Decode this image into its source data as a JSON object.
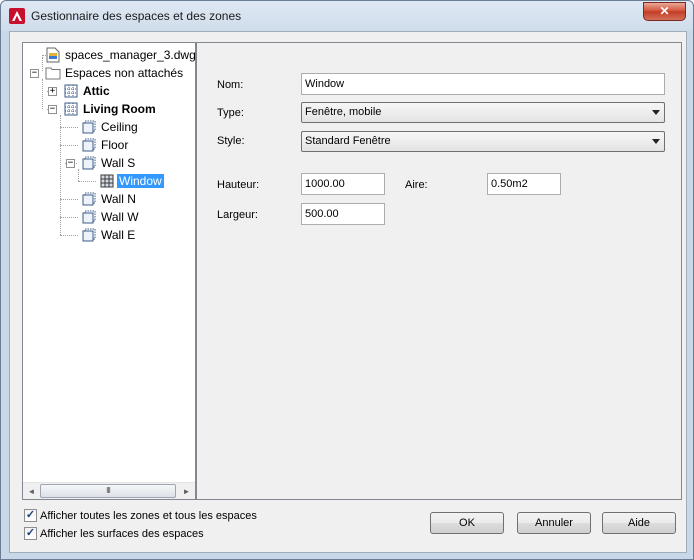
{
  "window": {
    "title": "Gestionnaire des espaces et des zones",
    "close_label": "✕"
  },
  "tree": {
    "file": "spaces_manager_3.dwg",
    "unattached": "Espaces non attachés",
    "attic": "Attic",
    "living_room": "Living Room",
    "ceiling": "Ceiling",
    "floor": "Floor",
    "wall_s": "Wall S",
    "window": "Window",
    "wall_n": "Wall N",
    "wall_w": "Wall W",
    "wall_e": "Wall E",
    "scroll_thumb_grip": "III",
    "scroll_left": "◄",
    "scroll_right": "►",
    "expand_plus": "+",
    "expand_minus": "−"
  },
  "properties": {
    "name_label": "Nom:",
    "name_value": "Window",
    "type_label": "Type:",
    "type_value": "Fenêtre, mobile",
    "style_label": "Style:",
    "style_value": "Standard Fenêtre",
    "height_label": "Hauteur:",
    "height_value": "1000.00",
    "area_label": "Aire:",
    "area_value": "0.50m2",
    "width_label": "Largeur:",
    "width_value": "500.00"
  },
  "options": {
    "show_all_label": "Afficher toutes les zones et tous les espaces",
    "show_all_checked": true,
    "show_surfaces_label": "Afficher les surfaces des espaces",
    "show_surfaces_checked": true,
    "check_mark": "✓"
  },
  "buttons": {
    "ok": "OK",
    "cancel": "Annuler",
    "help": "Aide"
  },
  "colors": {
    "selection": "#3399ff",
    "close_button": "#c23c24"
  }
}
